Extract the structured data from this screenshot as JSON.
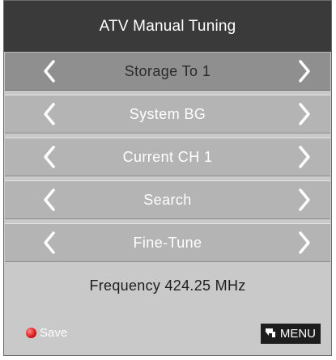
{
  "header": {
    "title": "ATV Manual Tuning"
  },
  "menu": {
    "items": [
      {
        "label": "Storage To 1",
        "selected": true
      },
      {
        "label": "System BG",
        "selected": false
      },
      {
        "label": "Current CH 1",
        "selected": false
      },
      {
        "label": "Search",
        "selected": false
      },
      {
        "label": "Fine-Tune",
        "selected": false
      }
    ],
    "arrow_left_icon": "chevron-left-icon",
    "arrow_right_icon": "chevron-right-icon"
  },
  "frequency": {
    "text": "Frequency 424.25  MHz"
  },
  "footer": {
    "save_label": "Save",
    "save_icon": "red-dot-icon",
    "menu_label": "MENU",
    "menu_icon": "return-arrow-icon"
  },
  "colors": {
    "header_bg": "#3a3a3a",
    "panel_bg": "#c9c9c9",
    "row_bg": "#b4b4b4",
    "row_selected_bg": "#8f8f8f",
    "save_dot": "#e01c1c"
  }
}
